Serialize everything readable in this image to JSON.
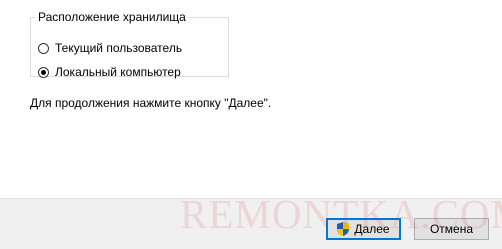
{
  "store_location": {
    "group_label": "Расположение хранилища",
    "options": [
      {
        "label": "Текущий пользователь",
        "selected": false
      },
      {
        "label": "Локальный компьютер",
        "selected": true
      }
    ]
  },
  "hint": "Для продолжения нажмите кнопку \"Далее\".",
  "buttons": {
    "next_label": "Далее",
    "cancel_label": "Отмена"
  },
  "watermark": "REMONTKA.COM",
  "colors": {
    "focus_border": "#0078d7",
    "footer_bg": "#f0f0f0",
    "button_bg": "#e1e1e1"
  },
  "icons": {
    "next_button_icon": "uac-shield-icon"
  }
}
